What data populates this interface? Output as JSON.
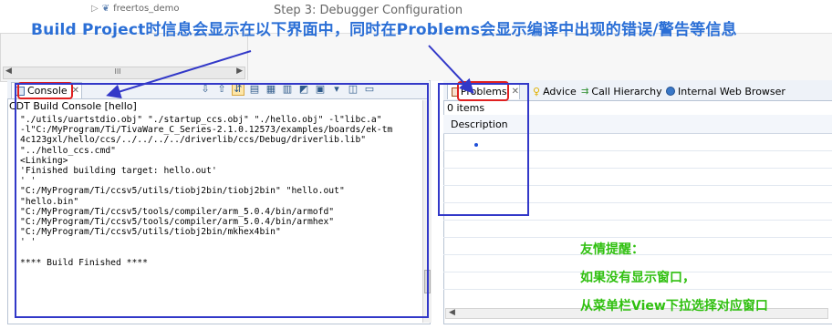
{
  "top": {
    "tree_item": "freertos_demo",
    "step_text": "Step 3:  Debugger Configuration",
    "scroll_thumb": "III"
  },
  "annotation": {
    "headline": "Build Project时信息会显示在以下界面中，同时在Problems会显示编译中出现的错误/警告等信息",
    "tip_title": "友情提醒：",
    "tip_line1": "如果没有显示窗口，",
    "tip_line2": "从菜单栏View下拉选择对应窗口",
    "colors": {
      "red": "#e02020",
      "blue": "#3238c8",
      "green": "#30c010",
      "headline": "#2b6fd6"
    }
  },
  "console": {
    "tab_label": "Console",
    "console_name": "CDT Build Console [hello]",
    "toolbar_icons": [
      "scroll-down-icon",
      "scroll-up-icon",
      "scroll-lock-icon",
      "copy-icon",
      "paste-icon",
      "clear-icon",
      "pin-icon",
      "display-console-icon",
      "open-console-icon",
      "minimize-icon",
      "maximize-icon"
    ],
    "output": "\"./utils/uartstdio.obj\" \"./startup_ccs.obj\" \"./hello.obj\" -l\"libc.a\"\n-l\"C:/MyProgram/Ti/TivaWare_C_Series-2.1.0.12573/examples/boards/ek-tm\n4c123gxl/hello/ccs/../../../../driverlib/ccs/Debug/driverlib.lib\"\n\"../hello_ccs.cmd\"\n<Linking>\n'Finished building target: hello.out'\n' '\n\"C:/MyProgram/Ti/ccsv5/utils/tiobj2bin/tiobj2bin\" \"hello.out\"\n\"hello.bin\"\n\"C:/MyProgram/Ti/ccsv5/tools/compiler/arm_5.0.4/bin/armofd\"\n\"C:/MyProgram/Ti/ccsv5/tools/compiler/arm_5.0.4/bin/armhex\"\n\"C:/MyProgram/Ti/ccsv5/utils/tiobj2bin/mkhex4bin\"\n' '\n\n**** Build Finished ****"
  },
  "problems": {
    "tabs": [
      {
        "label": "Problems",
        "icon": "problems-icon"
      },
      {
        "label": "Advice",
        "icon": "lightbulb-icon"
      },
      {
        "label": "Call Hierarchy",
        "icon": "call-hierarchy-icon"
      },
      {
        "label": "Internal Web Browser",
        "icon": "globe-icon"
      }
    ],
    "count": "0 items",
    "column": "Description"
  }
}
